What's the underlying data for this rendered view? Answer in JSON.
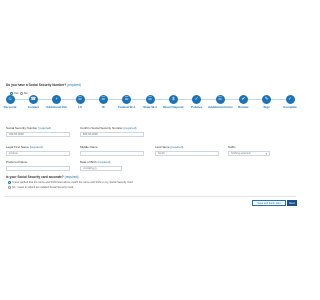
{
  "top_question": {
    "label": "Do you have a Social Security Number?",
    "required": "(required)",
    "yes": "Yes",
    "no": "No"
  },
  "steps": [
    {
      "label": "Personal",
      "icon": "person-icon",
      "glyph": "☺"
    },
    {
      "label": "Contact",
      "icon": "phone-icon",
      "glyph": "☎"
    },
    {
      "label": "Additional Info",
      "icon": "plus-icon",
      "glyph": "+"
    },
    {
      "label": "I-9",
      "icon": "document-icon",
      "glyph": "☰"
    },
    {
      "label": "I9",
      "icon": "document-icon",
      "glyph": "☰"
    },
    {
      "label": "Federal W-4",
      "icon": "document-icon",
      "glyph": "☰"
    },
    {
      "label": "State W-4",
      "icon": "document-icon",
      "glyph": "☰"
    },
    {
      "label": "Direct Deposit",
      "icon": "bank-icon",
      "glyph": "$"
    },
    {
      "label": "Policies",
      "icon": "policy-icon",
      "glyph": "✓"
    },
    {
      "label": "Additional Forms",
      "icon": "forms-icon",
      "glyph": "☰"
    },
    {
      "label": "Review",
      "icon": "review-icon",
      "glyph": "✔"
    },
    {
      "label": "Sign",
      "icon": "sign-icon",
      "glyph": "✎"
    },
    {
      "label": "Complete",
      "icon": "check-icon",
      "glyph": "✓"
    }
  ],
  "form": {
    "ssn": {
      "label": "Social Security Number",
      "required": "(required)",
      "value": "###-##-####"
    },
    "confirm_ssn": {
      "label": "Confirm Social Security Number",
      "required": "(required)",
      "value": "###-##-####"
    },
    "first_name": {
      "label": "Legal First Name",
      "required": "(required)",
      "value": "Andrew"
    },
    "middle_name": {
      "label": "Middle Name",
      "value": ""
    },
    "last_name": {
      "label": "Last Name",
      "required": "(required)",
      "value": "Smith"
    },
    "suffix": {
      "label": "Suffix",
      "value": "Nothing selected"
    },
    "preferred_name": {
      "label": "Preferred Name",
      "value": ""
    },
    "dob": {
      "label": "Date of Birth",
      "required": "(required)",
      "value": "mm/dd/yyyy"
    }
  },
  "accuracy": {
    "question": "Is your Social Security card accurate?",
    "required": "(required)",
    "option_yes": "I have verified that the name and SSN listed above match the name and SSN on my Social Security Card.",
    "option_no": "No, I need to submit an updated Social Security Card."
  },
  "buttons": {
    "save": "Save and finish later",
    "next": "Next"
  },
  "colors": {
    "accent": "#1a73b8",
    "next_button": "#1a4f8b"
  }
}
